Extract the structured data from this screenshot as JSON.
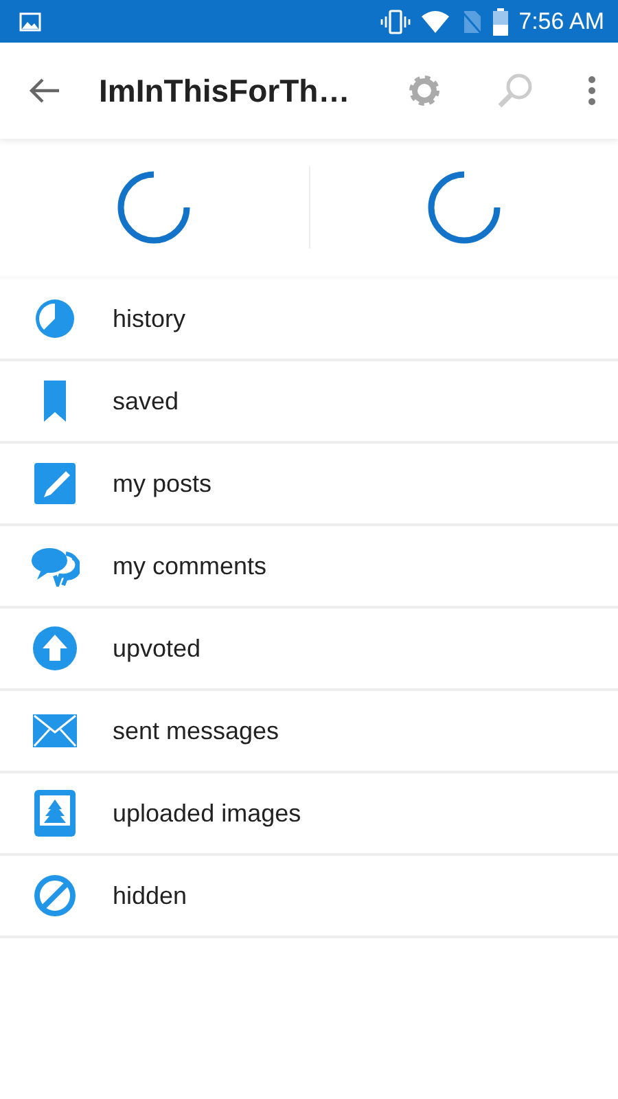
{
  "status_bar": {
    "time": "7:56 AM"
  },
  "app_bar": {
    "title": "ImInThisForTh…"
  },
  "menu": [
    {
      "kind": "history",
      "label": "history"
    },
    {
      "kind": "saved",
      "label": "saved"
    },
    {
      "kind": "posts",
      "label": "my posts"
    },
    {
      "kind": "comments",
      "label": "my comments"
    },
    {
      "kind": "upvoted",
      "label": "upvoted"
    },
    {
      "kind": "messages",
      "label": "sent messages"
    },
    {
      "kind": "images",
      "label": "uploaded images"
    },
    {
      "kind": "hidden",
      "label": "hidden"
    }
  ]
}
